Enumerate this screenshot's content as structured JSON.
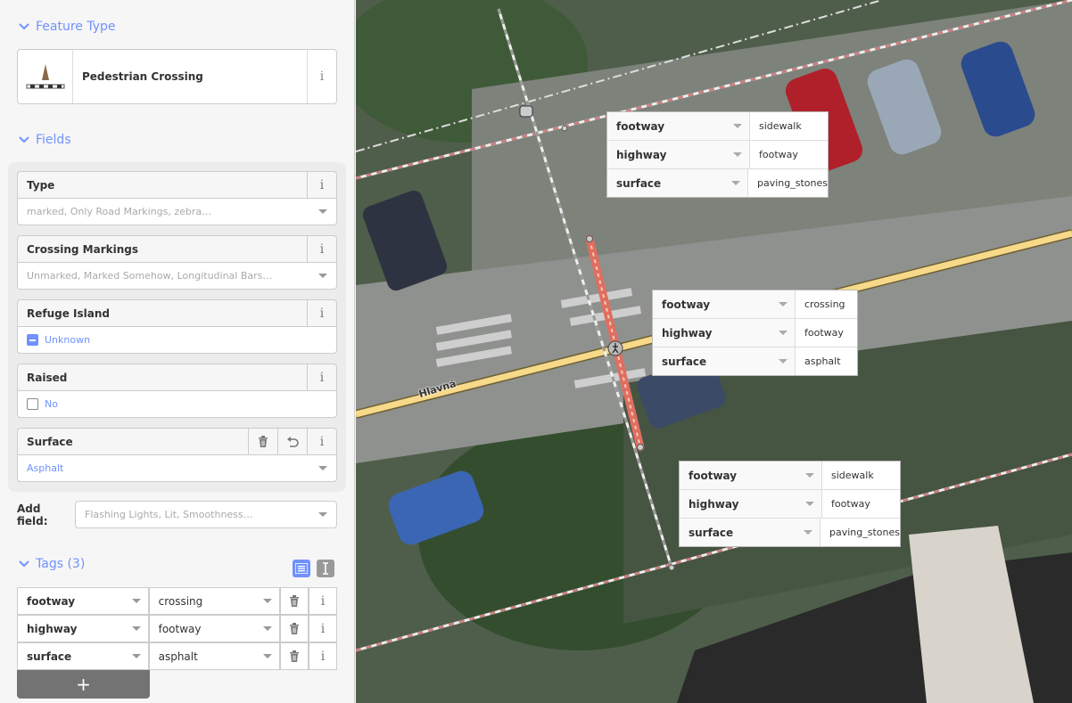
{
  "sidebar": {
    "feature_type": {
      "title": "Feature Type",
      "preset_name": "Pedestrian Crossing"
    },
    "fields": {
      "title": "Fields",
      "items": [
        {
          "label": "Type",
          "placeholder": "marked, Only Road Markings, zebra…",
          "kind": "combo"
        },
        {
          "label": "Crossing Markings",
          "placeholder": "Unmarked, Marked Somehow, Longitudinal Bars…",
          "kind": "combo"
        },
        {
          "label": "Refuge Island",
          "value": "Unknown",
          "kind": "check-indeterminate"
        },
        {
          "label": "Raised",
          "value": "No",
          "kind": "check"
        },
        {
          "label": "Surface",
          "value": "Asphalt",
          "kind": "combo"
        }
      ]
    },
    "add_field": {
      "label": "Add field:",
      "placeholder": "Flashing Lights, Lit, Smoothness…"
    },
    "tags": {
      "title": "Tags (3)",
      "rows": [
        {
          "key": "footway",
          "value": "crossing"
        },
        {
          "key": "highway",
          "value": "footway"
        },
        {
          "key": "surface",
          "value": "asphalt"
        }
      ],
      "add_label": "+"
    }
  },
  "map": {
    "street_name": "Hlavná",
    "popups": [
      {
        "rows": [
          {
            "key": "footway",
            "value": "sidewalk"
          },
          {
            "key": "highway",
            "value": "footway"
          },
          {
            "key": "surface",
            "value": "paving_stones"
          }
        ]
      },
      {
        "rows": [
          {
            "key": "footway",
            "value": "crossing"
          },
          {
            "key": "highway",
            "value": "footway"
          },
          {
            "key": "surface",
            "value": "asphalt"
          }
        ]
      },
      {
        "rows": [
          {
            "key": "footway",
            "value": "sidewalk"
          },
          {
            "key": "highway",
            "value": "footway"
          },
          {
            "key": "surface",
            "value": "paving_stones"
          }
        ]
      }
    ]
  },
  "icons": {
    "section_toggle": "chevron-down-icon",
    "info": "info-icon",
    "delete": "trash-icon",
    "revert": "undo-icon",
    "list_view": "list-view-icon",
    "text_view": "text-view-icon",
    "preset": "pedestrian-crossing-icon"
  },
  "colors": {
    "accent": "#7092ff",
    "selected_way": "#e06e5f",
    "primary_road": "#f7d98a",
    "add_tag_button": "#737373"
  }
}
